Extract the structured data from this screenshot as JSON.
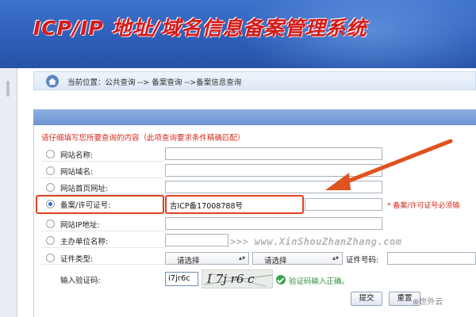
{
  "header": {
    "title": "ICP/IP 地址/域名信息备案管理系统"
  },
  "breadcrumb": {
    "text": "当前位置：公共查询 --> 备案查询 -->备案信息查询"
  },
  "form": {
    "instruction": "请仔细填写您所要查询的内容（此项查询要求条件精确匹配）",
    "fields": [
      {
        "label": "网站名称:"
      },
      {
        "label": "网站域名:"
      },
      {
        "label": "网站首页网址:"
      },
      {
        "label": "备案/许可证号:",
        "value": "吉ICP备17008788号",
        "selected": true
      },
      {
        "label": "网站IP地址:"
      },
      {
        "label": "主办单位名称:"
      },
      {
        "label": "证件类型:"
      }
    ],
    "license_required_note": "* 备案/许可证号必须输",
    "cert_type_select": "请选择",
    "cert_type_select_2": "请选择",
    "cert_number_label": "证件号码:",
    "captcha": {
      "label": "输入验证码:",
      "value": "i7jr6c",
      "image_text": "I 7j r6 c",
      "ok_message": "验证码输入正确。"
    },
    "buttons": {
      "submit": "提交",
      "reset": "重置"
    }
  },
  "watermark": {
    "site": ">>> www.XinShouZhanZhang.com",
    "brand": "⊕世外云"
  },
  "colors": {
    "header_bg": "#2e5fb8",
    "title_red": "#d41b1b",
    "highlight": "#e0421f",
    "note_red": "#d42b1e"
  }
}
